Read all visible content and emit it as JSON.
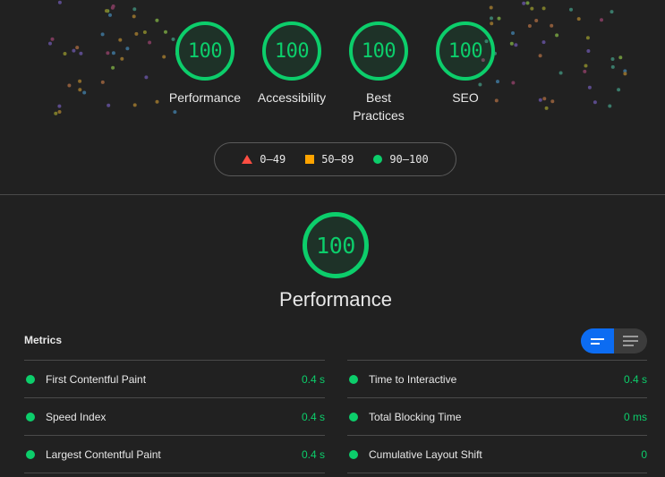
{
  "colors": {
    "background": "#212121",
    "pass": "#0cce6b",
    "average": "#ffa400",
    "fail": "#ff4e42",
    "toggle_active": "#0c6cf2"
  },
  "gauges": [
    {
      "label": "Performance",
      "score": "100"
    },
    {
      "label": "Accessibility",
      "score": "100"
    },
    {
      "label": "Best Practices",
      "score": "100"
    },
    {
      "label": "SEO",
      "score": "100"
    }
  ],
  "legend": [
    {
      "icon": "triangle-icon",
      "range": "0–49"
    },
    {
      "icon": "square-icon",
      "range": "50–89"
    },
    {
      "icon": "circle-icon",
      "range": "90–100"
    }
  ],
  "performance": {
    "score": "100",
    "title": "Performance",
    "metrics_title": "Metrics",
    "metrics_left": [
      {
        "name": "First Contentful Paint",
        "value": "0.4 s"
      },
      {
        "name": "Speed Index",
        "value": "0.4 s"
      },
      {
        "name": "Largest Contentful Paint",
        "value": "0.4 s"
      }
    ],
    "metrics_right": [
      {
        "name": "Time to Interactive",
        "value": "0.4 s"
      },
      {
        "name": "Total Blocking Time",
        "value": "0 ms"
      },
      {
        "name": "Cumulative Layout Shift",
        "value": "0"
      }
    ]
  }
}
